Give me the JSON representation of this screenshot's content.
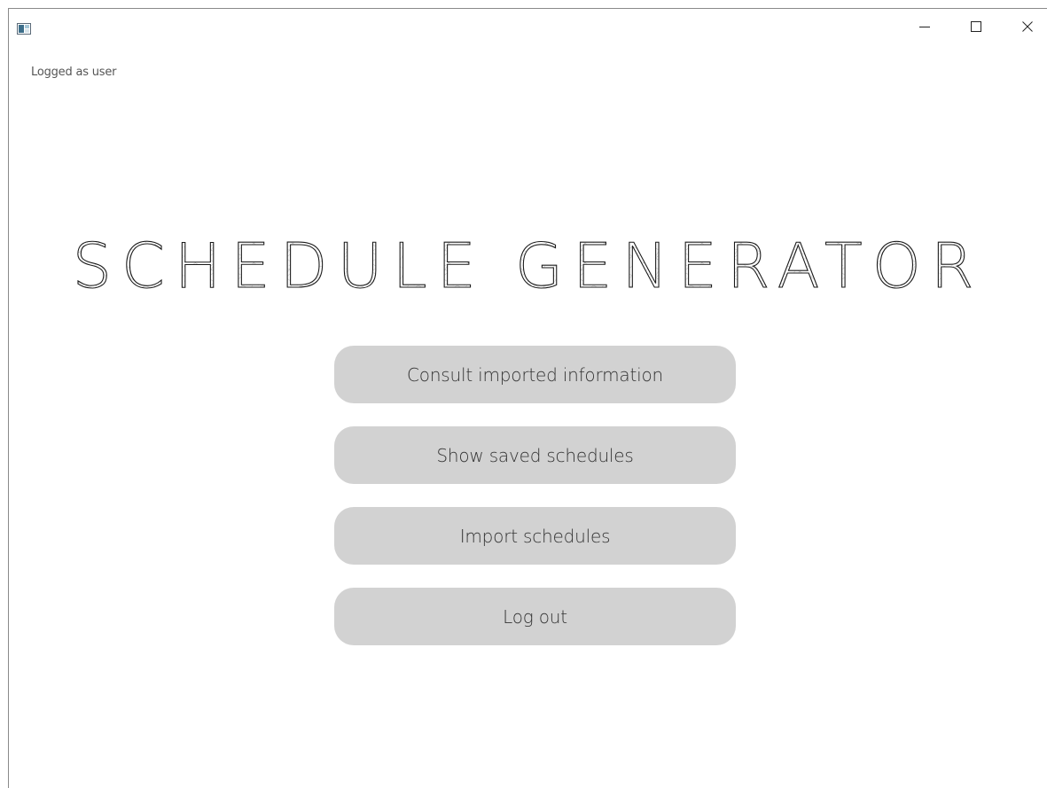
{
  "window": {
    "controls": {
      "minimize_icon": "minimize-icon",
      "maximize_icon": "maximize-icon",
      "close_icon": "close-icon"
    }
  },
  "status": {
    "logged_as": "Logged as user"
  },
  "title": {
    "text": "SCHEDULE GENERATOR"
  },
  "menu": {
    "consult_label": "Consult imported information",
    "saved_label": "Show saved schedules",
    "import_label": "Import schedules",
    "logout_label": "Log out"
  },
  "colors": {
    "button_bg": "#d2d2d2",
    "button_text": "#333333",
    "title_stroke": "#1a1a1a"
  }
}
